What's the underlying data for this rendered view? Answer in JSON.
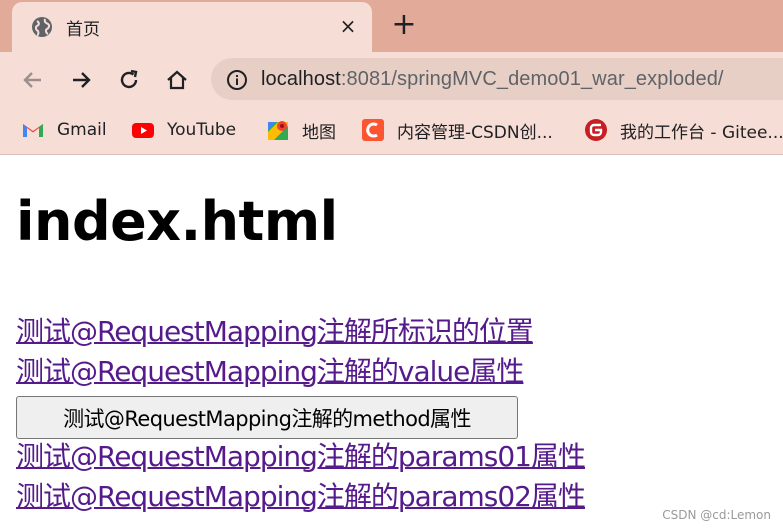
{
  "browser": {
    "tab_title": "首页",
    "tab_close": "×",
    "new_tab": "+",
    "url_host": "localhost",
    "url_rest": ":8081/springMVC_demo01_war_exploded/",
    "bookmarks": [
      {
        "label": "Gmail",
        "icon": "gmail-icon"
      },
      {
        "label": "YouTube",
        "icon": "youtube-icon"
      },
      {
        "label": "地图",
        "icon": "maps-icon"
      },
      {
        "label": "内容管理-CSDN创...",
        "icon": "csdn-icon"
      },
      {
        "label": "我的工作台 - Gitee...",
        "icon": "gitee-icon"
      }
    ],
    "colors": {
      "tabstrip": "#e2aa98",
      "toolbar": "#f6ddd6",
      "omnibox": "#e7cfc6"
    }
  },
  "page": {
    "heading": "index.html",
    "link1": "测试@RequestMapping注解所标识的位置",
    "link2": "测试@RequestMapping注解的value属性",
    "method_button": "测试@RequestMapping注解的method属性",
    "link3": "测试@RequestMapping注解的params01属性",
    "link4": "测试@RequestMapping注解的params02属性",
    "link_color": "#551a8b"
  },
  "watermark": "CSDN @cd:Lemon"
}
